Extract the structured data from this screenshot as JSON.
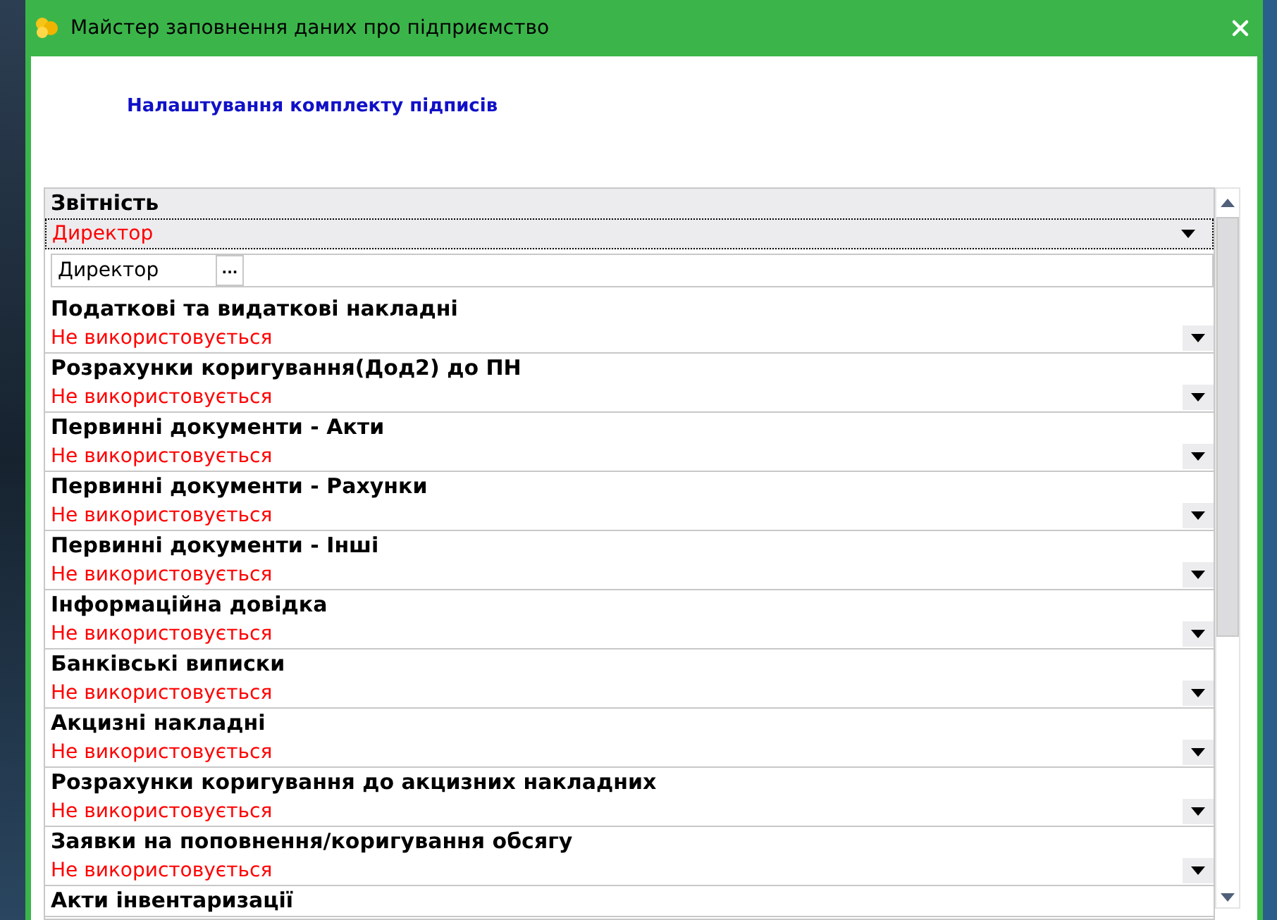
{
  "window": {
    "title": "Майстер заповнення даних про підприємство"
  },
  "heading": "Налаштування комплекту підписів",
  "groups": [
    {
      "kind": "current",
      "title": "Звітність",
      "value": "Директор",
      "signer": {
        "value": "Директор",
        "button": "..."
      }
    },
    {
      "kind": "item",
      "title": "Податкові та видаткові накладні",
      "value": "Не використовується"
    },
    {
      "kind": "item",
      "title": "Розрахунки коригування(Дод2) до ПН",
      "value": "Не використовується"
    },
    {
      "kind": "item",
      "title": "Первинні документи - Акти",
      "value": "Не використовується"
    },
    {
      "kind": "item",
      "title": "Первинні документи - Рахунки",
      "value": "Не використовується"
    },
    {
      "kind": "item",
      "title": "Первинні документи - Інші",
      "value": "Не використовується"
    },
    {
      "kind": "item",
      "title": "Інформаційна довідка",
      "value": "Не використовується"
    },
    {
      "kind": "item",
      "title": "Банківські виписки",
      "value": "Не використовується"
    },
    {
      "kind": "item",
      "title": "Акцизні накладні",
      "value": "Не використовується"
    },
    {
      "kind": "item",
      "title": "Розрахунки коригування до акцизних накладних",
      "value": "Не використовується"
    },
    {
      "kind": "item",
      "title": "Заявки на поповнення/коригування обсягу",
      "value": "Не використовується"
    },
    {
      "kind": "item",
      "title": "Акти інвентаризації"
    }
  ]
}
